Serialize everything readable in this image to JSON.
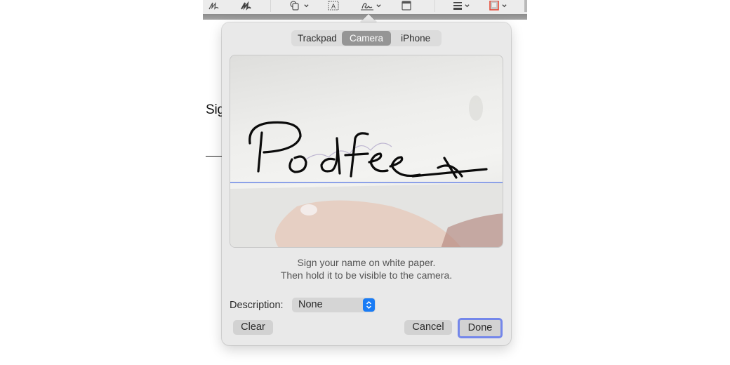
{
  "toolbar": {
    "icons": [
      "sketch-icon",
      "draw-icon",
      "shapes-icon",
      "text-box-icon",
      "signature-icon",
      "note-icon",
      "line-style-icon",
      "border-color-icon"
    ],
    "border_color": "#e8412f"
  },
  "document": {
    "visible_text": "Sig"
  },
  "signature_popover": {
    "tabs": [
      {
        "label": "Trackpad",
        "selected": false
      },
      {
        "label": "Camera",
        "selected": true
      },
      {
        "label": "iPhone",
        "selected": false
      }
    ],
    "camera_preview": {
      "signature_text": "Podfeet",
      "baseline_color": "#6b86e6"
    },
    "instructions": [
      "Sign your name on white paper.",
      "Then hold it to be visible to the camera."
    ],
    "description_label": "Description:",
    "description_value": "None",
    "buttons": {
      "clear": "Clear",
      "cancel": "Cancel",
      "done": "Done"
    },
    "accent_color": "#1a7cf5",
    "focus_ring_color": "#7487ea"
  }
}
